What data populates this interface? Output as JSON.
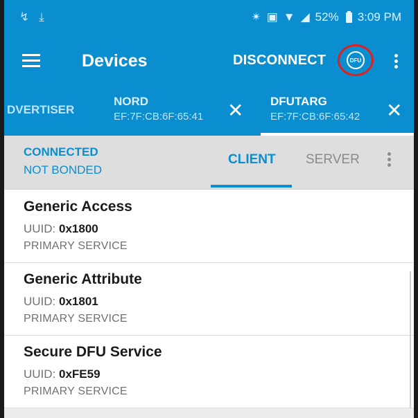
{
  "status_bar": {
    "left_icons": [
      "missed-call-icon",
      "download-icon"
    ],
    "battery_percent": "52%",
    "time": "3:09 PM"
  },
  "toolbar": {
    "title": "Devices",
    "disconnect_label": "DISCONNECT",
    "dfu_label": "DFU"
  },
  "device_tabs": [
    {
      "name": "DVERTISER",
      "address": ""
    },
    {
      "name": "NORD",
      "address": "EF:7F:CB:6F:65:41"
    },
    {
      "name": "DFUTARG",
      "address": "EF:7F:CB:6F:65:42"
    }
  ],
  "connection": {
    "state": "CONNECTED",
    "bond": "NOT BONDED"
  },
  "sub_tabs": {
    "client": "CLIENT",
    "server": "SERVER"
  },
  "services": [
    {
      "name": "Generic Access",
      "uuid_label": "UUID: ",
      "uuid": "0x1800",
      "type": "PRIMARY SERVICE"
    },
    {
      "name": "Generic Attribute",
      "uuid_label": "UUID: ",
      "uuid": "0x1801",
      "type": "PRIMARY SERVICE"
    },
    {
      "name": "Secure DFU Service",
      "uuid_label": "UUID: ",
      "uuid": "0xFE59",
      "type": "PRIMARY SERVICE"
    }
  ],
  "colors": {
    "primary": "#0a8ecf",
    "highlight_circle": "#e02020"
  }
}
